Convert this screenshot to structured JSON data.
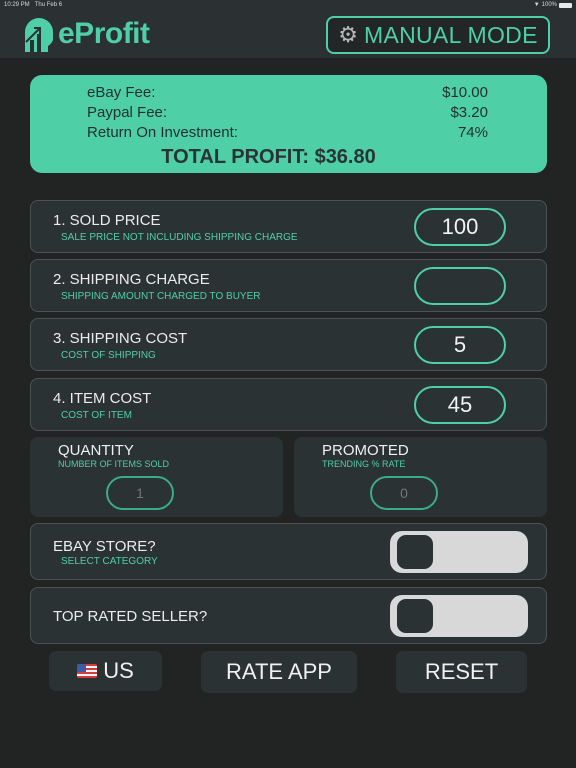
{
  "status_bar": {
    "time": "10:29 PM",
    "date": "Thu Feb 6",
    "battery": "100%"
  },
  "app": {
    "name": "eProfit"
  },
  "header": {
    "mode_button": "MANUAL MODE"
  },
  "summary": {
    "rows": [
      {
        "label": "eBay Fee:",
        "value": "$10.00"
      },
      {
        "label": "Paypal Fee:",
        "value": "$3.20"
      },
      {
        "label": "Return On Investment:",
        "value": "74%"
      }
    ],
    "total": "TOTAL PROFIT: $36.80"
  },
  "fields": [
    {
      "title": "1. SOLD PRICE",
      "subtitle": "SALE PRICE NOT INCLUDING SHIPPING CHARGE",
      "value": "100"
    },
    {
      "title": "2. SHIPPING CHARGE",
      "subtitle": "SHIPPING AMOUNT CHARGED TO BUYER",
      "value": ""
    },
    {
      "title": "3. SHIPPING COST",
      "subtitle": "COST OF SHIPPING",
      "value": "5"
    },
    {
      "title": "4. ITEM COST",
      "subtitle": "COST OF ITEM",
      "value": "45"
    }
  ],
  "quantity": {
    "title": "QUANTITY",
    "subtitle": "NUMBER OF ITEMS SOLD",
    "placeholder": "1"
  },
  "promoted": {
    "title": "PROMOTED",
    "subtitle": "TRENDING % RATE",
    "placeholder": "0"
  },
  "toggles": [
    {
      "title": "EBAY STORE?",
      "subtitle": "SELECT CATEGORY",
      "on": false
    },
    {
      "title": "TOP RATED SELLER?",
      "on": false
    }
  ],
  "buttons": {
    "country": "US",
    "rate": "RATE APP",
    "reset": "RESET"
  },
  "colors": {
    "accent": "#4ecfa6",
    "card": "#2b3234",
    "background": "#222424"
  }
}
